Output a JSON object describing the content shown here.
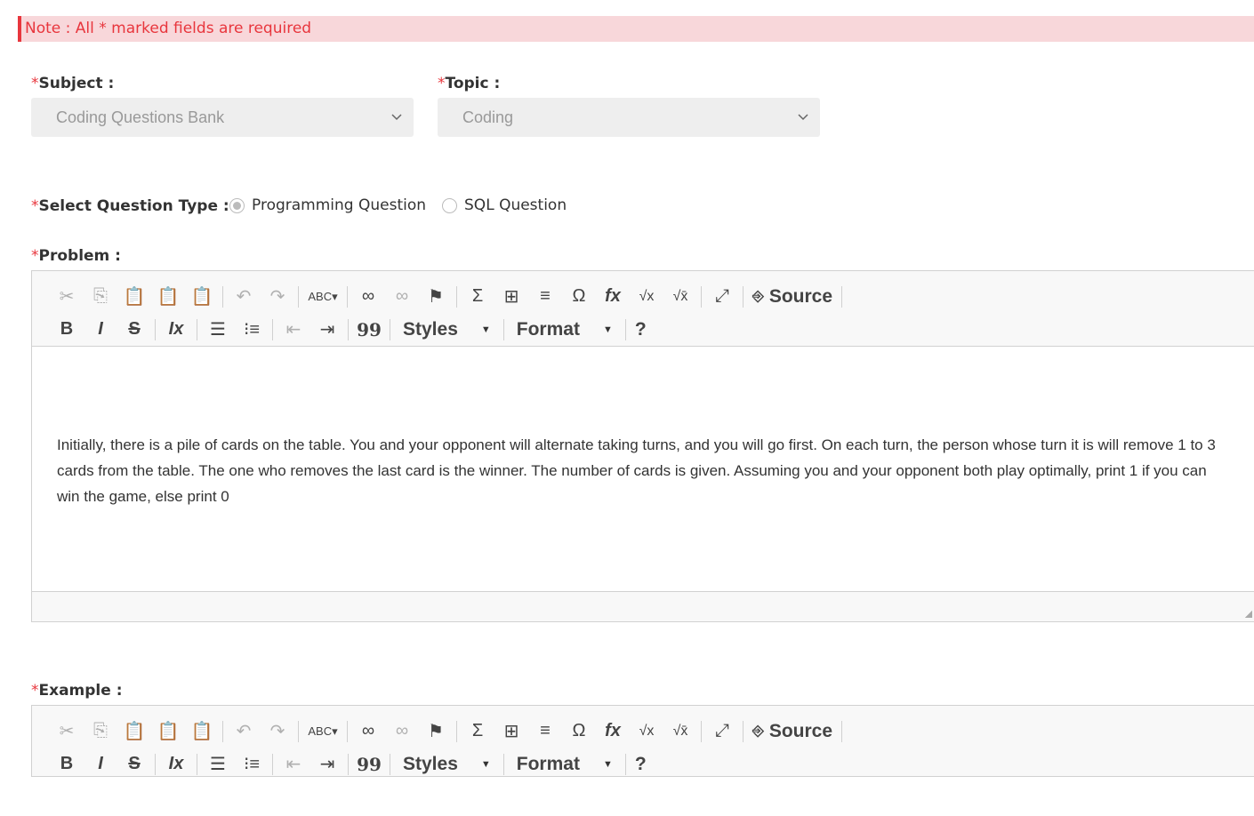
{
  "note": "Note : All * marked fields are required",
  "required_mark": "*",
  "subject": {
    "label": "Subject :",
    "value": "Coding Questions Bank"
  },
  "topic": {
    "label": "Topic :",
    "value": "Coding"
  },
  "question_type": {
    "label": "Select Question Type :",
    "options": [
      {
        "label": "Programming Question",
        "selected": true
      },
      {
        "label": "SQL Question",
        "selected": false
      }
    ]
  },
  "problem": {
    "label": "Problem :",
    "content": "Initially, there is a pile of cards on the table. You and your opponent will alternate taking turns, and you will go first. On each turn, the person whose turn it is will remove 1 to 3 cards from the table. The one who removes the last card is the winner. The number of cards is given. Assuming you and your opponent both play optimally, print 1 if you can win the game, else print 0"
  },
  "example": {
    "label": "Example :"
  },
  "toolbar": {
    "source_label": "Source",
    "styles_label": "Styles",
    "format_label": "Format",
    "help_label": "?",
    "bold": "B",
    "italic": "I",
    "strike": "S",
    "quote": "99",
    "row1_icons": [
      "cut-icon",
      "copy-icon",
      "paste-icon",
      "paste-text-icon",
      "paste-word-icon",
      "undo-icon",
      "redo-icon",
      "spellcheck-icon",
      "link-icon",
      "unlink-icon",
      "anchor-flag-icon",
      "math-sigma-icon",
      "table-icon",
      "horizontal-rule-icon",
      "special-char-omega-icon",
      "formula-fx-icon",
      "sqrt-x-icon",
      "sqrt-box-icon",
      "maximize-icon",
      "source-icon"
    ],
    "row2_icons": [
      "bold-icon",
      "italic-icon",
      "strikethrough-icon",
      "remove-format-icon",
      "numbered-list-icon",
      "bulleted-list-icon",
      "outdent-icon",
      "indent-icon",
      "blockquote-icon"
    ]
  },
  "colors": {
    "accent_red": "#e8363d",
    "note_bg": "#f8d7da",
    "toolbar_bg": "#f8f8f8"
  }
}
